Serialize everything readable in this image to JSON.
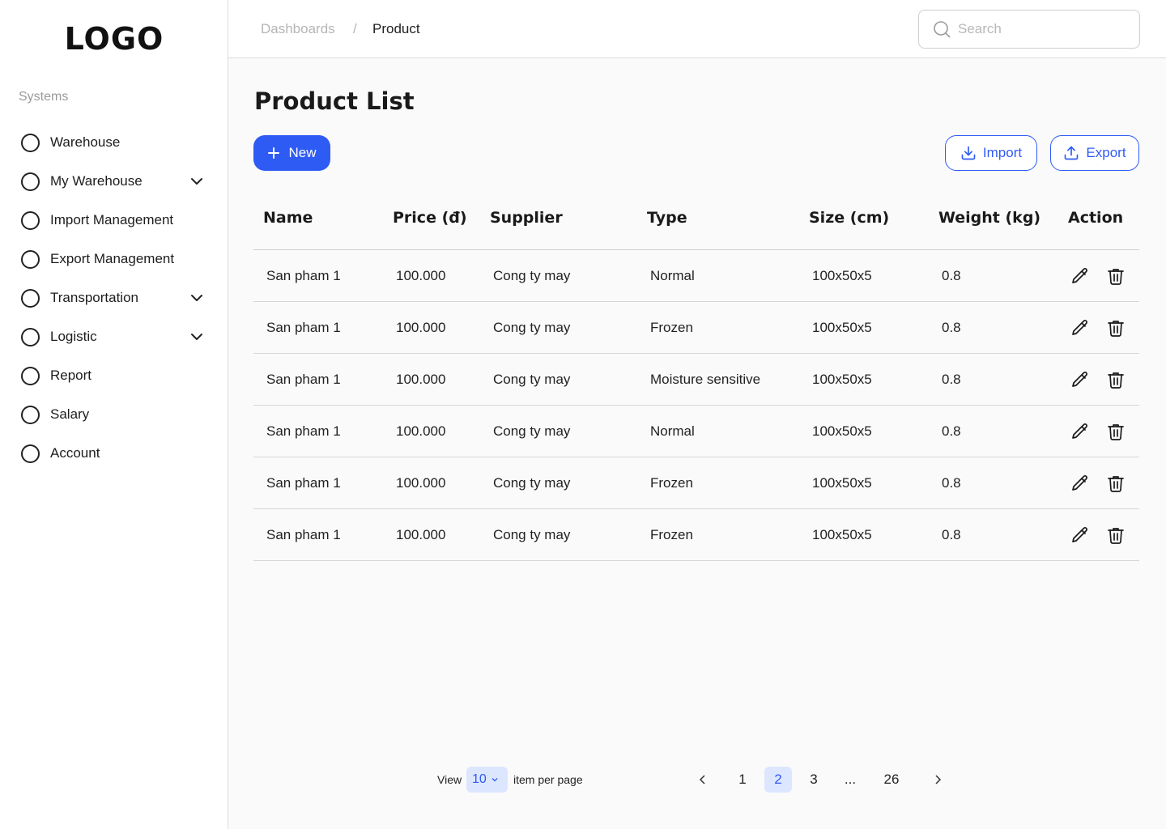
{
  "brand": {
    "logo": "LOGO"
  },
  "sidebar": {
    "section_label": "Systems",
    "items": [
      {
        "label": "Warehouse",
        "expandable": false
      },
      {
        "label": "My Warehouse",
        "expandable": true
      },
      {
        "label": "Import Management",
        "expandable": false
      },
      {
        "label": "Export Management",
        "expandable": false
      },
      {
        "label": "Transportation",
        "expandable": true
      },
      {
        "label": "Logistic",
        "expandable": true
      },
      {
        "label": "Report",
        "expandable": false
      },
      {
        "label": "Salary",
        "expandable": false
      },
      {
        "label": "Account",
        "expandable": false
      }
    ]
  },
  "header": {
    "breadcrumb": [
      "Dashboards",
      "Product"
    ],
    "breadcrumb_separator": "/",
    "search": {
      "placeholder": "Search",
      "value": ""
    }
  },
  "main": {
    "title": "Product List",
    "buttons": {
      "new": "New",
      "import": "Import",
      "export": "Export"
    },
    "table": {
      "columns": [
        "Name",
        "Price (đ)",
        "Supplier",
        "Type",
        "Size (cm)",
        "Weight (kg)",
        "Action"
      ],
      "rows": [
        [
          "San pham 1",
          "100.000",
          "Cong ty may",
          "Normal",
          "100x50x5",
          "0.8"
        ],
        [
          "San pham 1",
          "100.000",
          "Cong ty may",
          "Frozen",
          "100x50x5",
          "0.8"
        ],
        [
          "San pham 1",
          "100.000",
          "Cong ty may",
          "Moisture sensitive",
          "100x50x5",
          "0.8"
        ],
        [
          "San pham 1",
          "100.000",
          "Cong ty may",
          "Normal",
          "100x50x5",
          "0.8"
        ],
        [
          "San pham 1",
          "100.000",
          "Cong ty may",
          "Frozen",
          "100x50x5",
          "0.8"
        ],
        [
          "San pham 1",
          "100.000",
          "Cong ty may",
          "Frozen",
          "100x50x5",
          "0.8"
        ]
      ]
    },
    "pagination": {
      "view_label": "View",
      "per_page_value": "10",
      "per_page_suffix": "item per page",
      "pages": [
        "1",
        "2",
        "3",
        "...",
        "26"
      ],
      "current_page": "2"
    }
  },
  "colors": {
    "accent": "#2f5bf5",
    "accent_light": "#dde6ff",
    "border": "#dcdcdc",
    "background": "#fafafa"
  }
}
